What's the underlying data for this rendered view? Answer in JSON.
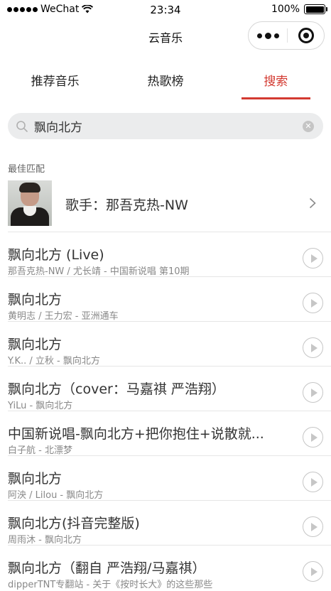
{
  "status_bar": {
    "carrier": "WeChat",
    "time": "23:34",
    "battery": "100%"
  },
  "nav": {
    "title": "云音乐"
  },
  "tabs": [
    {
      "label": "推荐音乐",
      "active": false
    },
    {
      "label": "热歌榜",
      "active": false
    },
    {
      "label": "搜索",
      "active": true
    }
  ],
  "search": {
    "value": "飘向北方"
  },
  "best_match": {
    "label": "最佳匹配",
    "text": "歌手：那吾克热-NW"
  },
  "songs": [
    {
      "title": "飘向北方 (Live)",
      "subtitle": "那吾克热-NW / 尤长靖 - 中国新说唱 第10期"
    },
    {
      "title": "飘向北方",
      "subtitle": "黄明志 / 王力宏 - 亚洲通车"
    },
    {
      "title": "飘向北方",
      "subtitle": "Y.K.. / 立秋 - 飘向北方"
    },
    {
      "title": "飘向北方（cover：马嘉祺 严浩翔）",
      "subtitle": "YiLu - 飘向北方"
    },
    {
      "title": "中国新说唱-飘向北方+把你抱住+说散就...",
      "subtitle": "白子航 - 北漂梦"
    },
    {
      "title": "飘向北方",
      "subtitle": "阿泱 / Lilou - 飘向北方"
    },
    {
      "title": "飘向北方(抖音完整版)",
      "subtitle": "周雨沐 - 飘向北方"
    },
    {
      "title": "飘向北方（翻自 严浩翔/马嘉祺）",
      "subtitle": "dipperTNT专翻站 - 关于《按时长大》的这些那些"
    }
  ],
  "colors": {
    "accent": "#d33a31",
    "search_bg": "#ebeced",
    "subtitle": "#888888"
  }
}
